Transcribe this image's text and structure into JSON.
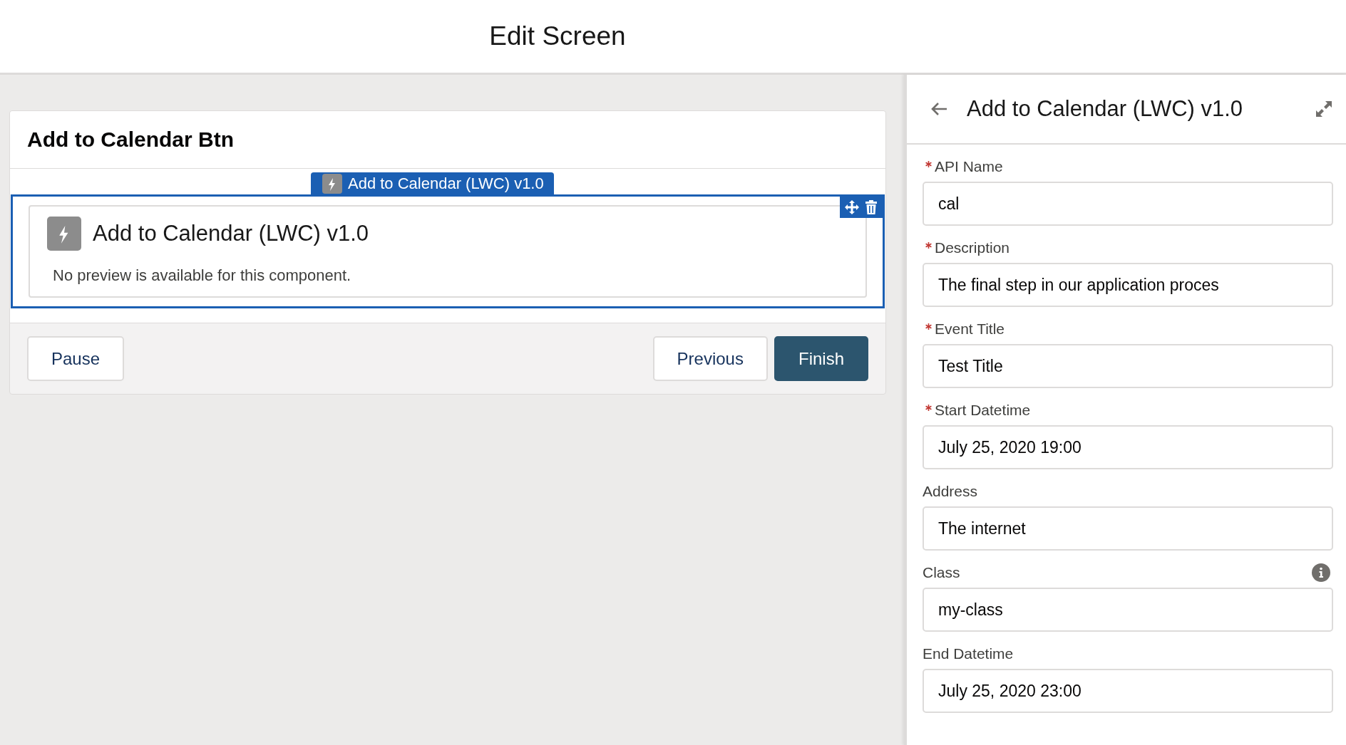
{
  "header": {
    "title": "Edit Screen"
  },
  "canvas": {
    "screen_title": "Add to Calendar Btn",
    "component": {
      "tag_label": "Add to Calendar (LWC) v1.0",
      "selected": true,
      "title": "Add to Calendar (LWC) v1.0",
      "message": "No preview is available for this component."
    },
    "footer_left_buttons": [
      {
        "label": "Pause",
        "kind": "neutral"
      }
    ],
    "footer_right_buttons": [
      {
        "label": "Previous",
        "kind": "neutral"
      },
      {
        "label": "Finish",
        "kind": "brand"
      }
    ]
  },
  "properties_panel": {
    "title": "Add to Calendar (LWC) v1.0",
    "fields": [
      {
        "label": "API Name",
        "required": true,
        "info": false,
        "value": "cal"
      },
      {
        "label": "Description",
        "required": true,
        "info": false,
        "value": "The final step in our application proces"
      },
      {
        "label": "Event Title",
        "required": true,
        "info": false,
        "value": "Test Title"
      },
      {
        "label": "Start Datetime",
        "required": true,
        "info": false,
        "value": "July 25, 2020 19:00"
      },
      {
        "label": "Address",
        "required": false,
        "info": false,
        "value": "The internet"
      },
      {
        "label": "Class",
        "required": false,
        "info": true,
        "value": "my-class"
      },
      {
        "label": "End Datetime",
        "required": false,
        "info": false,
        "value": "July 25, 2020 23:00"
      }
    ]
  }
}
